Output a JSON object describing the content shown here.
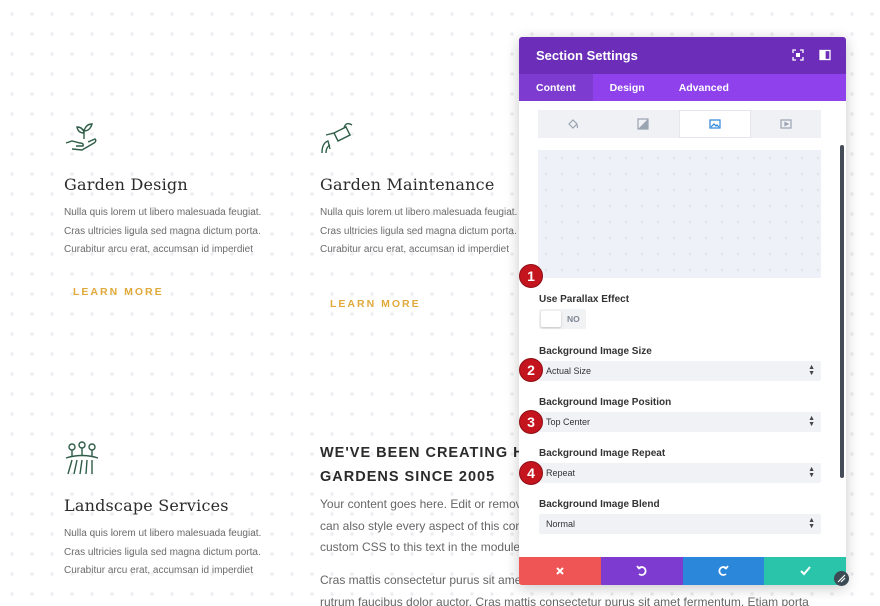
{
  "services": [
    {
      "title": "Garden Design",
      "icon": "hand-sprout-icon",
      "text": [
        "Nulla quis lorem ut libero malesuada feugiat.",
        "Cras ultricies ligula sed magna dictum porta.",
        "Curabitur arcu erat, accumsan id imperdiet"
      ],
      "cta": "LEARN MORE"
    },
    {
      "title": "Garden Maintenance",
      "icon": "watering-can-icon",
      "text": [
        "Nulla quis lorem ut libero malesuada feugiat.",
        "Cras ultricies ligula sed magna dictum porta.",
        "Curabitur arcu erat, accumsan id imperdiet"
      ],
      "cta": "LEARN MORE"
    },
    {
      "title": "Landscape Services",
      "icon": "trees-field-icon",
      "text": [
        "Nulla quis lorem ut libero malesuada feugiat.",
        "Cras ultricies ligula sed magna dictum porta.",
        "Curabitur arcu erat, accumsan id imperdiet"
      ]
    }
  ],
  "about": {
    "heading_line1": "WE'VE BEEN CREATING HIGH",
    "heading_line2": "GARDENS SINCE 2005",
    "paragraph1": [
      "Your content goes here. Edit or remove",
      "can also style every aspect of this conte",
      "custom CSS to this text in the module A"
    ],
    "paragraph2": [
      "Cras mattis consectetur purus sit amet",
      "rutrum faucibus dolor auctor. Cras mattis consectetur purus sit amet fermentum. Etiam porta"
    ]
  },
  "panel": {
    "title": "Section Settings",
    "tabs": [
      "Content",
      "Design",
      "Advanced"
    ],
    "bg_subtabs": [
      "paint-bucket-icon",
      "gradient-icon",
      "image-icon",
      "video-icon"
    ],
    "parallax_label": "Use Parallax Effect",
    "parallax_value": "NO",
    "size_label": "Background Image Size",
    "size_value": "Actual Size",
    "position_label": "Background Image Position",
    "position_value": "Top Center",
    "repeat_label": "Background Image Repeat",
    "repeat_value": "Repeat",
    "blend_label": "Background Image Blend",
    "blend_value": "Normal",
    "badges": [
      "1",
      "2",
      "3",
      "4"
    ]
  },
  "colors": {
    "panel_header": "#6c2eb9",
    "panel_tabs": "#8f42ec",
    "cta": "#e0a93a",
    "cancel": "#ef5555",
    "undo": "#7e3bd0",
    "redo": "#2b87da",
    "save": "#29c4a9",
    "badge": "#c4141e"
  }
}
